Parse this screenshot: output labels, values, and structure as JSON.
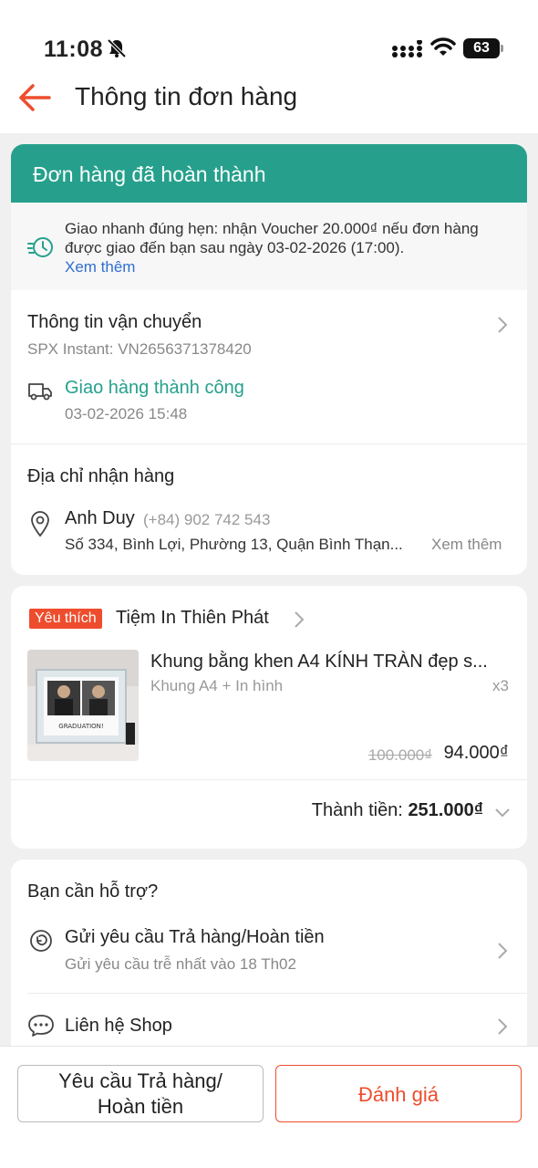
{
  "status_bar": {
    "time": "11:08",
    "battery": "63"
  },
  "header": {
    "title": "Thông tin đơn hàng"
  },
  "order_status": {
    "title": "Đơn hàng đã hoàn thành",
    "voucher_notice": "Giao nhanh đúng hẹn: nhận Voucher 20.000₫ nếu đơn hàng được giao đến bạn sau ngày 03-02-2026 (17:00).",
    "voucher_link": "Xem thêm"
  },
  "shipping": {
    "title": "Thông tin vận chuyển",
    "carrier": "SPX Instant: VN2656371378420",
    "status": "Giao hàng thành công",
    "time": "03-02-2026 15:48"
  },
  "address": {
    "title": "Địa chỉ nhận hàng",
    "name": "Anh Duy",
    "phone": "(+84) 902 742 543",
    "line": "Số 334, Bình Lợi, Phường 13, Quận Bình Thạn...",
    "more": "Xem thêm"
  },
  "shop": {
    "badge": "Yêu thích",
    "name": "Tiệm In Thiên Phát",
    "product": {
      "name": "Khung bằng khen A4 KÍNH TRÀN đẹp s...",
      "variant": "Khung A4 + In hình",
      "qty": "x3",
      "old_price": "100.000₫",
      "price": "94.000₫",
      "image_caption": "GRADUATION!"
    },
    "total_label": "Thành tiền:",
    "total_value": "251.000₫"
  },
  "support": {
    "title": "Bạn cần hỗ trợ?",
    "return_title": "Gửi yêu cầu Trả hàng/Hoàn tiền",
    "return_sub": "Gửi yêu cầu trễ nhất vào 18 Th02",
    "contact": "Liên hệ Shop"
  },
  "footer": {
    "return_line1": "Yêu cầu Trả hàng/",
    "return_line2": "Hoàn tiền",
    "rate": "Đánh giá"
  },
  "colors": {
    "accent": "#ee4d2d",
    "success": "#26a08c",
    "link": "#2f6fd1"
  }
}
